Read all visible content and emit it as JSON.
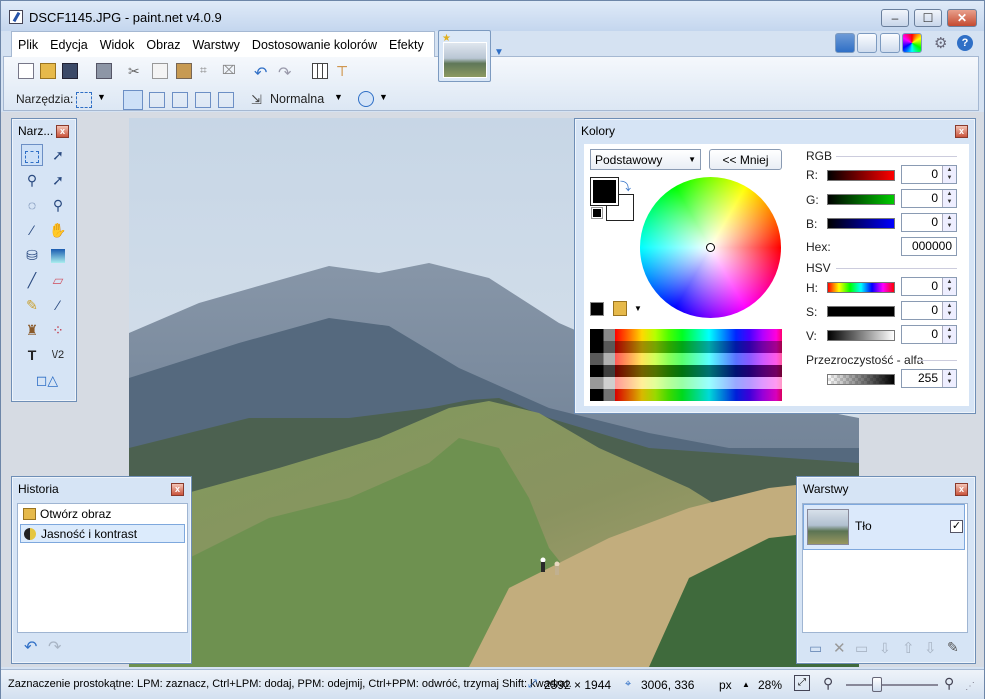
{
  "window": {
    "title": "DSCF1145.JPG - paint.net v4.0.9",
    "controls": [
      "–",
      "☐",
      "✕"
    ]
  },
  "menu": [
    "Plik",
    "Edycja",
    "Widok",
    "Obraz",
    "Warstwy",
    "Dostosowanie kolorów",
    "Efekty"
  ],
  "toolbar": {
    "tools_label": "Narzędzia:",
    "blend_mode": "Normalna"
  },
  "tools_panel": {
    "title": "Narz..."
  },
  "history_panel": {
    "title": "Historia",
    "items": [
      {
        "label": "Otwórz obraz",
        "icon": "folder-icon"
      },
      {
        "label": "Jasność i kontrast",
        "icon": "adjustment-icon"
      }
    ]
  },
  "colors_panel": {
    "title": "Kolory",
    "palette_select": "Podstawowy",
    "less_button": "<< Mniej",
    "rgb_label": "RGB",
    "r_label": "R:",
    "g_label": "G:",
    "b_label": "B:",
    "r": "0",
    "g": "0",
    "b": "0",
    "hex_label": "Hex:",
    "hex": "000000",
    "hsv_label": "HSV",
    "h_label": "H:",
    "s_label": "S:",
    "v_label": "V:",
    "h": "0",
    "s": "0",
    "v": "0",
    "alpha_label": "Przezroczystość - alfa",
    "alpha": "255",
    "primary_color": "#000000",
    "secondary_color": "#ffffff"
  },
  "layers_panel": {
    "title": "Warstwy",
    "layer_name": "Tło",
    "layer_visible": true
  },
  "status": {
    "hint": "Zaznaczenie prostokątne: LPM: zaznacz, Ctrl+LPM: dodaj, PPM: odejmij, Ctrl+PPM: odwróć, trzymaj Shift: kwadrat.",
    "image_size": "2592 × 1944",
    "cursor_pos": "3006, 336",
    "units": "px",
    "zoom": "28%"
  },
  "colors": {
    "accent": "#2f6fc6",
    "panel_bg": "#d6e4f5"
  }
}
